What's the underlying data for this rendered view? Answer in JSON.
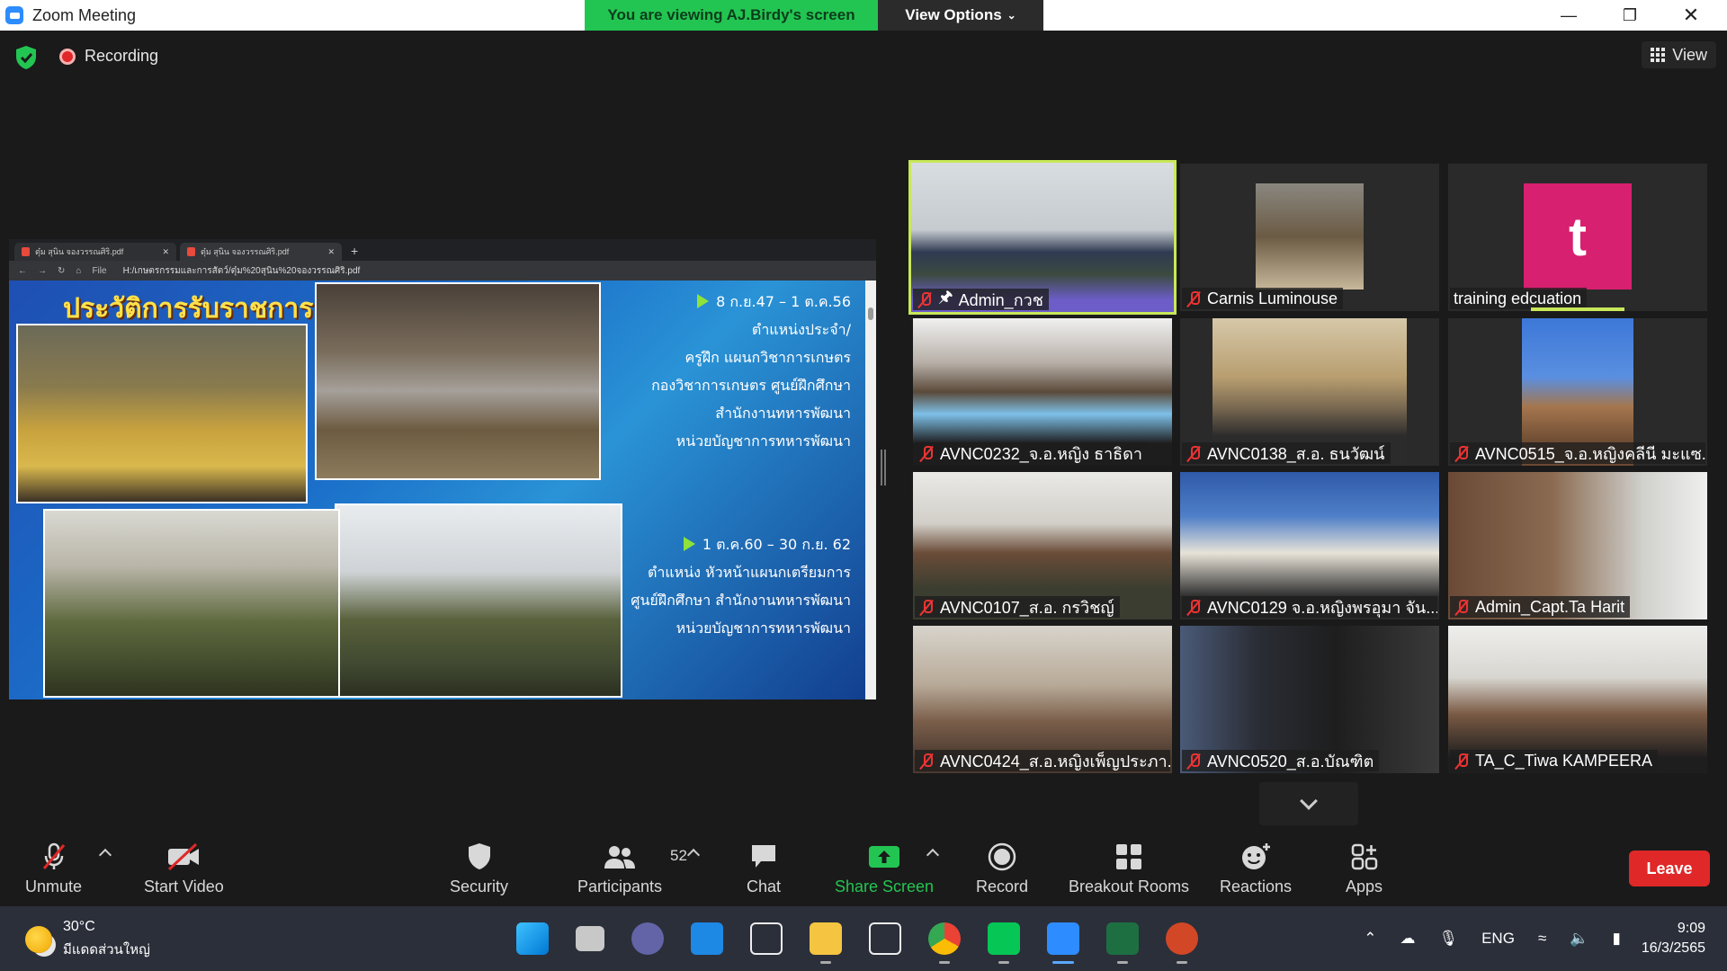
{
  "window": {
    "title": "Zoom Meeting",
    "banner": "You are viewing AJ.Birdy's screen",
    "view_options": "View Options"
  },
  "top": {
    "recording": "Recording",
    "view": "View"
  },
  "shared_screen": {
    "tabs": [
      "ตุ๋ม สุนิน จองวรรณศิริ.pdf",
      "ตุ๋ม สุนิน จองวรรณศิริ.pdf"
    ],
    "file_label": "File",
    "url": "H:/เกษตรกรรมและการสัตว์/ตุ๋ม%20สุนิน%20จองวรรณศิริ.pdf",
    "slide_title": "ประวัติการรับราชการ",
    "block1": [
      "8 ก.ย.47 – 1 ต.ค.56",
      "ตำแหน่งประจำ/",
      "ครูฝึก แผนกวิชาการเกษตร",
      "กองวิชาการเกษตร ศูนย์ฝึกศึกษา",
      "สำนักงานทหารพัฒนา",
      "หน่วยบัญชาการทหารพัฒนา"
    ],
    "block2": [
      "1 ต.ค.60 – 30 ก.ย. 62",
      "ตำแหน่ง หัวหน้าแผนกเตรียมการ",
      "ศูนย์ฝึกศึกษา  สำนักงานทหารพัฒนา",
      "หน่วยบัญชาการทหารพัฒนา"
    ]
  },
  "participants": [
    {
      "name": "Admin_กวช",
      "muted": true,
      "pinned": true
    },
    {
      "name": "Carnis Luminouse",
      "muted": true
    },
    {
      "name": "training edcuation",
      "muted": false,
      "avatar": "t"
    },
    {
      "name": "AVNC0232_จ.อ.หญิง ธาธิดา",
      "muted": true
    },
    {
      "name": "AVNC0138_ส.อ. ธนวัฒน์",
      "muted": true
    },
    {
      "name": "AVNC0515_จ.อ.หญิงคลีนี มะแซ...",
      "muted": true
    },
    {
      "name": "AVNC0107_ส.อ. กรวิชญ์",
      "muted": true
    },
    {
      "name": "AVNC0129 จ.อ.หญิงพรอุมา  จัน...",
      "muted": true
    },
    {
      "name": "Admin_Capt.Ta Harit",
      "muted": true
    },
    {
      "name": "AVNC0424_ส.อ.หญิงเพ็ญประภา...",
      "muted": true
    },
    {
      "name": "AVNC0520_ส.อ.บัณฑิต",
      "muted": true
    },
    {
      "name": "TA_C_Tiwa KAMPEERA",
      "muted": true
    }
  ],
  "toolbar": {
    "unmute": "Unmute",
    "start_video": "Start Video",
    "security": "Security",
    "participants": "Participants",
    "participants_count": "52",
    "chat": "Chat",
    "share_screen": "Share Screen",
    "record": "Record",
    "breakout_rooms": "Breakout Rooms",
    "reactions": "Reactions",
    "apps": "Apps",
    "leave": "Leave"
  },
  "taskbar": {
    "temperature": "30°C",
    "weather": "มีแดดส่วนใหญ่",
    "language": "ENG",
    "time": "9:09",
    "date": "16/3/2565"
  },
  "colors": {
    "accent_green": "#23c552",
    "leave_red": "#e02828",
    "active_border": "#c8e85a"
  }
}
